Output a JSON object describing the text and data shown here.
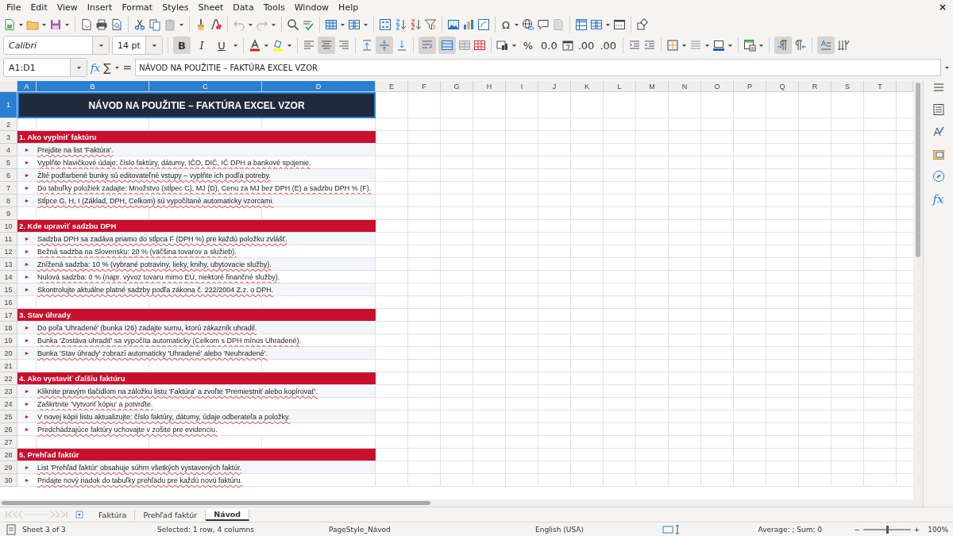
{
  "menu_bar": {
    "items": [
      "File",
      "Edit",
      "View",
      "Insert",
      "Format",
      "Styles",
      "Sheet",
      "Data",
      "Tools",
      "Window",
      "Help"
    ],
    "close": "×"
  },
  "standard_toolbar": {
    "special_character": "Ω"
  },
  "formatting_toolbar": {
    "font_name": "Calibri",
    "font_size": "14 pt",
    "buttons": [
      {
        "kind": "bold",
        "label": "B",
        "on": true
      },
      {
        "kind": "italic",
        "label": "I",
        "on": false
      },
      {
        "kind": "underline",
        "label": "U",
        "on": false
      },
      {
        "kind": "font-color",
        "on": false
      },
      {
        "kind": "highlight",
        "on": false
      },
      {
        "kind": "align-left",
        "on": false
      },
      {
        "kind": "align-center",
        "on": true
      },
      {
        "kind": "align-right",
        "on": false
      },
      {
        "kind": "align-top",
        "on": false
      },
      {
        "kind": "align-middle",
        "on": true
      },
      {
        "kind": "align-bottom",
        "on": false
      },
      {
        "kind": "wrap",
        "on": true
      },
      {
        "kind": "merge",
        "on": true
      },
      {
        "kind": "unmerge",
        "on": false
      },
      {
        "kind": "split-cells",
        "on": false
      },
      {
        "kind": "currency",
        "on": false
      },
      {
        "kind": "percent",
        "label": "%",
        "on": false
      },
      {
        "kind": "number",
        "label": "0.0",
        "on": false
      },
      {
        "kind": "date",
        "on": false
      },
      {
        "kind": "add-decimal",
        "label": ".00",
        "on": false
      },
      {
        "kind": "delete-decimal",
        "label": ".00",
        "on": false
      },
      {
        "kind": "indent",
        "on": false
      },
      {
        "kind": "outdent",
        "on": false
      },
      {
        "kind": "borders",
        "on": false
      },
      {
        "kind": "border-style",
        "on": false
      },
      {
        "kind": "border-color",
        "on": false
      },
      {
        "kind": "conditional",
        "on": false
      },
      {
        "kind": "ltr",
        "on": true
      },
      {
        "kind": "rtl",
        "on": false
      },
      {
        "kind": "text-direction",
        "on": true
      },
      {
        "kind": "vertical-text",
        "on": false
      }
    ]
  },
  "formula_bar": {
    "name_box": "A1:D1",
    "function_wizard": "fx",
    "sum": "∑",
    "equals": "=",
    "content": "NÁVOD NA POUŽITIE – FAKTÚRA EXCEL VZOR"
  },
  "columns": [
    {
      "label": "A",
      "selected": true
    },
    {
      "label": "B",
      "selected": true
    },
    {
      "label": "C",
      "selected": true
    },
    {
      "label": "D",
      "selected": true
    },
    {
      "label": "E",
      "selected": false
    },
    {
      "label": "F",
      "selected": false
    },
    {
      "label": "G",
      "selected": false
    },
    {
      "label": "H",
      "selected": false
    },
    {
      "label": "I",
      "selected": false
    },
    {
      "label": "J",
      "selected": false
    },
    {
      "label": "K",
      "selected": false
    },
    {
      "label": "L",
      "selected": false
    },
    {
      "label": "M",
      "selected": false
    },
    {
      "label": "N",
      "selected": false
    },
    {
      "label": "O",
      "selected": false
    },
    {
      "label": "P",
      "selected": false
    },
    {
      "label": "Q",
      "selected": false
    },
    {
      "label": "R",
      "selected": false
    },
    {
      "label": "S",
      "selected": false
    },
    {
      "label": "T",
      "selected": false
    }
  ],
  "rows": [
    {
      "number": "1",
      "kind": "title",
      "selected": true,
      "text": "NÁVOD NA POUŽITIE – FAKTÚRA EXCEL VZOR"
    },
    {
      "number": "2",
      "kind": "blank",
      "selected": false
    },
    {
      "number": "3",
      "kind": "section",
      "selected": false,
      "text": "1. Ako vyplniť faktúru"
    },
    {
      "number": "4",
      "kind": "item",
      "selected": false,
      "bullet": "►",
      "text": "Prejdite na list 'Faktúra'."
    },
    {
      "number": "5",
      "kind": "item",
      "selected": false,
      "bullet": "►",
      "text": "Vyplňte hlavičkové údaje: číslo faktúry, dátumy, IČO, DIČ, IČ DPH a bankové spojenie."
    },
    {
      "number": "6",
      "kind": "item",
      "selected": false,
      "bullet": "►",
      "text": "Žlté podfarbené bunky sú editovateľné vstupy – vyplňte ich podľa potreby."
    },
    {
      "number": "7",
      "kind": "item",
      "selected": false,
      "bullet": "►",
      "text": "Do tabuľky položiek zadajte: Množstvo (stĺpec C), MJ (D), Cenu za MJ bez DPH (E) a sadzbu DPH % (F)."
    },
    {
      "number": "8",
      "kind": "item",
      "selected": false,
      "bullet": "►",
      "text": "Stĺpce G, H, I (Základ, DPH, Celkom) sú vypočítané automaticky vzorcami."
    },
    {
      "number": "9",
      "kind": "blank",
      "selected": false
    },
    {
      "number": "10",
      "kind": "section",
      "selected": false,
      "text": "2. Kde upraviť sadzbu DPH"
    },
    {
      "number": "11",
      "kind": "item",
      "selected": false,
      "bullet": "►",
      "text": "Sadzba DPH sa zadáva priamo do stĺpca F (DPH %) pre každú položku zvlášť."
    },
    {
      "number": "12",
      "kind": "item",
      "selected": false,
      "bullet": "►",
      "text": "Bežná sadzba na Slovensku: 20 % (väčšina tovarov a služieb)."
    },
    {
      "number": "13",
      "kind": "item",
      "selected": false,
      "bullet": "►",
      "text": "Znížená sadzba: 10 % (vybrané potraviny, lieky, knihy, ubytovacie služby)."
    },
    {
      "number": "14",
      "kind": "item",
      "selected": false,
      "bullet": "►",
      "text": "Nulová sadzba: 0 % (napr. vývoz tovaru mimo EÚ, niektoré finančné služby)."
    },
    {
      "number": "15",
      "kind": "item",
      "selected": false,
      "bullet": "►",
      "text": "Skontrolujte aktuálne platné sadzby podľa zákona č. 222/2004 Z.z. o DPH."
    },
    {
      "number": "16",
      "kind": "blank",
      "selected": false
    },
    {
      "number": "17",
      "kind": "section",
      "selected": false,
      "text": "3. Stav úhrady"
    },
    {
      "number": "18",
      "kind": "item",
      "selected": false,
      "bullet": "►",
      "text": "Do poľa 'Uhradené' (bunka I26) zadajte sumu, ktorú zákazník uhradil."
    },
    {
      "number": "19",
      "kind": "item",
      "selected": false,
      "bullet": "►",
      "text": "Bunka 'Zostáva uhradiť' sa vypočíta automaticky (Celkom s DPH mínus Uhradené)."
    },
    {
      "number": "20",
      "kind": "item",
      "selected": false,
      "bullet": "►",
      "text": "Bunka 'Stav úhrady' zobrazí automaticky 'Uhradené' alebo 'Neuhradené'."
    },
    {
      "number": "21",
      "kind": "blank",
      "selected": false
    },
    {
      "number": "22",
      "kind": "section",
      "selected": false,
      "text": "4. Ako vystaviť ďalšiu faktúru"
    },
    {
      "number": "23",
      "kind": "item",
      "selected": false,
      "bullet": "►",
      "text": "Kliknite pravým tlačidlom na záložku listu 'Faktúra' a zvoľte 'Premiestniť alebo kopírovať'."
    },
    {
      "number": "24",
      "kind": "item",
      "selected": false,
      "bullet": "►",
      "text": "Zaškrtnite 'Vytvoriť kópiu' a potvrďte."
    },
    {
      "number": "25",
      "kind": "item",
      "selected": false,
      "bullet": "►",
      "text": "V novej kópii listu aktualizujte: číslo faktúry, dátumy, údaje odberateľa a položky."
    },
    {
      "number": "26",
      "kind": "item",
      "selected": false,
      "bullet": "►",
      "text": "Predchádzajúce faktúry uchovajte v zošite pre evidenciu."
    },
    {
      "number": "27",
      "kind": "blank",
      "selected": false
    },
    {
      "number": "28",
      "kind": "section",
      "selected": false,
      "text": "5. Prehľad faktúr"
    },
    {
      "number": "29",
      "kind": "item",
      "selected": false,
      "bullet": "►",
      "text": "List 'Prehľad faktúr' obsahuje súhrn všetkých vystavených faktúr."
    },
    {
      "number": "30",
      "kind": "item",
      "selected": false,
      "bullet": "►",
      "text": "Pridajte nový riadok do tabuľky prehľadu pre každú novú faktúru."
    }
  ],
  "sidebar": {
    "functions": "fx"
  },
  "sheet_tabs": [
    {
      "label": "Faktúra",
      "selected": false
    },
    {
      "label": "Prehľad faktúr",
      "selected": false
    },
    {
      "label": "Návod",
      "selected": true
    }
  ],
  "status_bar": {
    "sheet": "Sheet 3 of 3",
    "selection": "Selected: 1 row, 4 columns",
    "page_style": "PageStyle_Návod",
    "language": "English (USA)",
    "summary": "Average: ; Sum: 0",
    "zoom_minus": "−",
    "zoom_plus": "+",
    "zoom": {
      "level": 0.5
    },
    "zoom_value": "100%"
  }
}
